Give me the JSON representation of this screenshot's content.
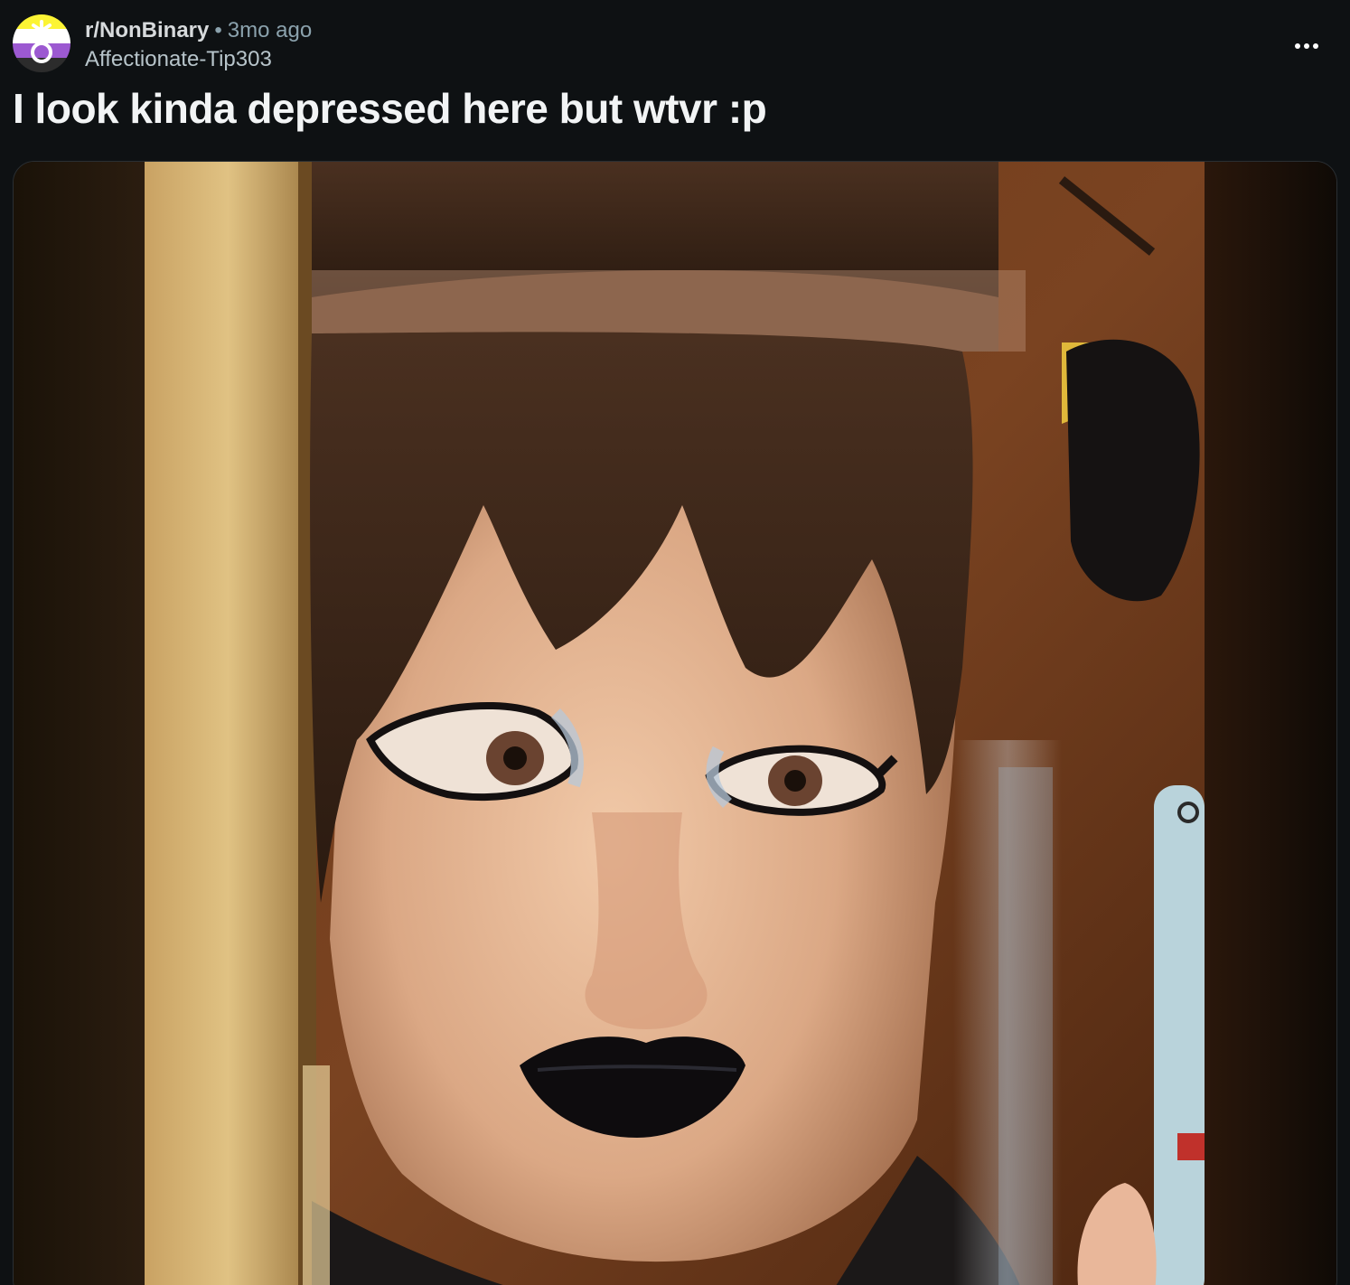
{
  "post": {
    "subreddit": "r/NonBinary",
    "separator": "•",
    "time_ago": "3mo ago",
    "author": "Affectionate-Tip303",
    "title": "I look kinda depressed here but wtvr :p",
    "more_icon": "ellipsis-horizontal-icon",
    "avatar_icon": "nonbinary-symbol-icon"
  },
  "colors": {
    "background": "#0e1113",
    "nonbinary_flag": [
      "#fcf434",
      "#ffffff",
      "#9c59d1",
      "#2c2c2c"
    ]
  },
  "media": {
    "type": "photo",
    "icon": "post-image-icon"
  }
}
